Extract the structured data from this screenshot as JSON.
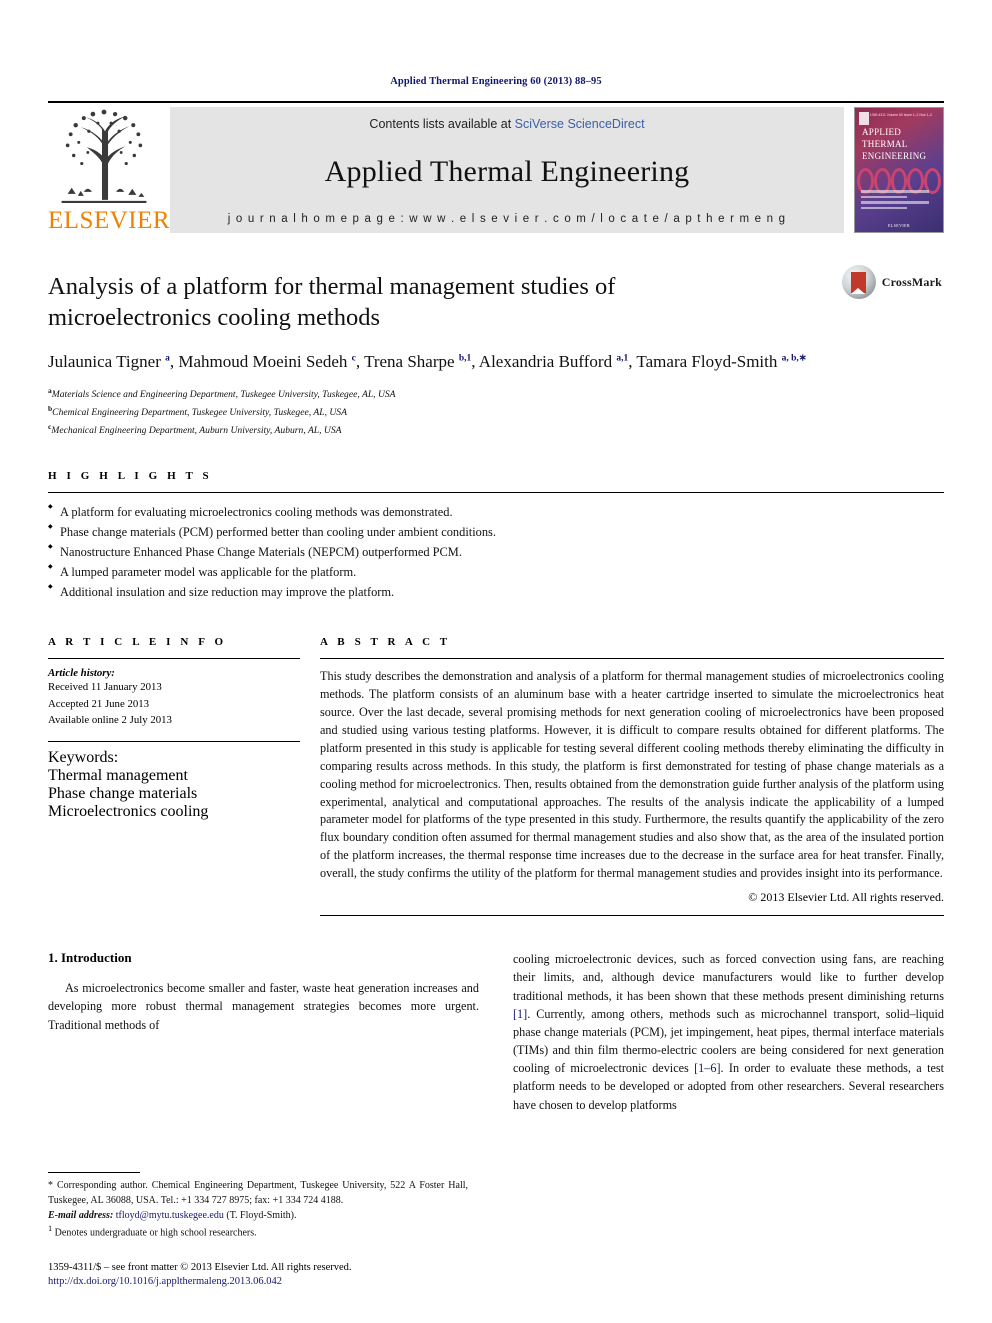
{
  "running_head": "Applied Thermal Engineering 60 (2013) 88–95",
  "masthead": {
    "publisher_logo_text": "ELSEVIER",
    "contents_prefix": "Contents lists available at ",
    "contents_link": "SciVerse ScienceDirect",
    "journal_title": "Applied Thermal Engineering",
    "homepage_label": "j o u r n a l   h o m e p a g e :   w w w . e l s e v i e r . c o m / l o c a t e / a p t h e r m e n g",
    "cover": {
      "line1": "APPLIED",
      "line2": "THERMAL",
      "line3": "ENGINEERING",
      "top_meta": "ISSN 1359-4311 Volume 60 Issue 1–2  Nos 1–2",
      "footer": "ELSEVIER"
    }
  },
  "article": {
    "title": "Analysis of a platform for thermal management studies of microelectronics cooling methods",
    "crossmark_label": "CrossMark",
    "authors_html": "Julaunica Tigner <sup>a</sup>, Mahmoud Moeini Sedeh <sup>c</sup>, Trena Sharpe <sup>b,1</sup>, Alexandria Bufford <sup>a,1</sup>, Tamara Floyd-Smith <sup>a, b,∗</sup>",
    "affiliations": [
      {
        "marker": "a",
        "text": "Materials Science and Engineering Department, Tuskegee University, Tuskegee, AL, USA"
      },
      {
        "marker": "b",
        "text": "Chemical Engineering Department, Tuskegee University, Tuskegee, AL, USA"
      },
      {
        "marker": "c",
        "text": "Mechanical Engineering Department, Auburn University, Auburn, AL, USA"
      }
    ]
  },
  "highlights": {
    "label": "H I G H L I G H T S",
    "items": [
      "A platform for evaluating microelectronics cooling methods was demonstrated.",
      "Phase change materials (PCM) performed better than cooling under ambient conditions.",
      "Nanostructure Enhanced Phase Change Materials (NEPCM) outperformed PCM.",
      "A lumped parameter model was applicable for the platform.",
      "Additional insulation and size reduction may improve the platform."
    ]
  },
  "article_info": {
    "label": "A R T I C L E    I N F O",
    "history_heading": "Article history:",
    "history": [
      "Received 11 January 2013",
      "Accepted 21 June 2013",
      "Available online 2 July 2013"
    ],
    "keywords_heading": "Keywords:",
    "keywords": [
      "Thermal management",
      "Phase change materials",
      "Microelectronics cooling"
    ]
  },
  "abstract": {
    "label": "A B S T R A C T",
    "text": "This study describes the demonstration and analysis of a platform for thermal management studies of microelectronics cooling methods. The platform consists of an aluminum base with a heater cartridge inserted to simulate the microelectronics heat source. Over the last decade, several promising methods for next generation cooling of microelectronics have been proposed and studied using various testing platforms. However, it is difficult to compare results obtained for different platforms. The platform presented in this study is applicable for testing several different cooling methods thereby eliminating the difficulty in comparing results across methods. In this study, the platform is first demonstrated for testing of phase change materials as a cooling method for microelectronics. Then, results obtained from the demonstration guide further analysis of the platform using experimental, analytical and computational approaches. The results of the analysis indicate the applicability of a lumped parameter model for platforms of the type presented in this study. Furthermore, the results quantify the applicability of the zero flux boundary condition often assumed for thermal management studies and also show that, as the area of the insulated portion of the platform increases, the thermal response time increases due to the decrease in the surface area for heat transfer. Finally, overall, the study confirms the utility of the platform for thermal management studies and provides insight into its performance.",
    "copyright": "© 2013 Elsevier Ltd. All rights reserved."
  },
  "body": {
    "section_heading": "1. Introduction",
    "column_left_p1": "As microelectronics become smaller and faster, waste heat generation increases and developing more robust thermal management strategies becomes more urgent. Traditional methods of",
    "column_right_part1": "cooling microelectronic devices, such as forced convection using fans, are reaching their limits, and, although device manufacturers would like to further develop traditional methods, it has been shown that these methods present diminishing returns ",
    "ref1": "[1]",
    "column_right_part2": ". Currently, among others, methods such as microchannel transport, solid–liquid phase change materials (PCM), jet impingement, heat pipes, thermal interface materials (TIMs) and thin film thermo-electric coolers are being considered for next generation cooling of microelectronic devices ",
    "ref2": "[1–6]",
    "column_right_part3": ". In order to evaluate these methods, a test platform needs to be developed or adopted from other researchers. Several researchers have chosen to develop platforms"
  },
  "footnotes": {
    "corresponding": "* Corresponding author. Chemical Engineering Department, Tuskegee University, 522 A Foster Hall, Tuskegee, AL 36088, USA. Tel.: +1 334 727 8975; fax: +1 334 724 4188.",
    "email_label": "E-mail address:",
    "email": "tfloyd@mytu.tuskegee.edu",
    "email_suffix": " (T. Floyd-Smith).",
    "note1_marker": "1",
    "note1": "Denotes undergraduate or high school researchers.",
    "issn_line": "1359-4311/$ – see front matter © 2013 Elsevier Ltd. All rights reserved.",
    "doi": "http://dx.doi.org/10.1016/j.applthermaleng.2013.06.042"
  },
  "colors": {
    "link": "#14186b",
    "sciencedirect": "#3b5fa8",
    "elsevier_orange": "#f08000"
  }
}
